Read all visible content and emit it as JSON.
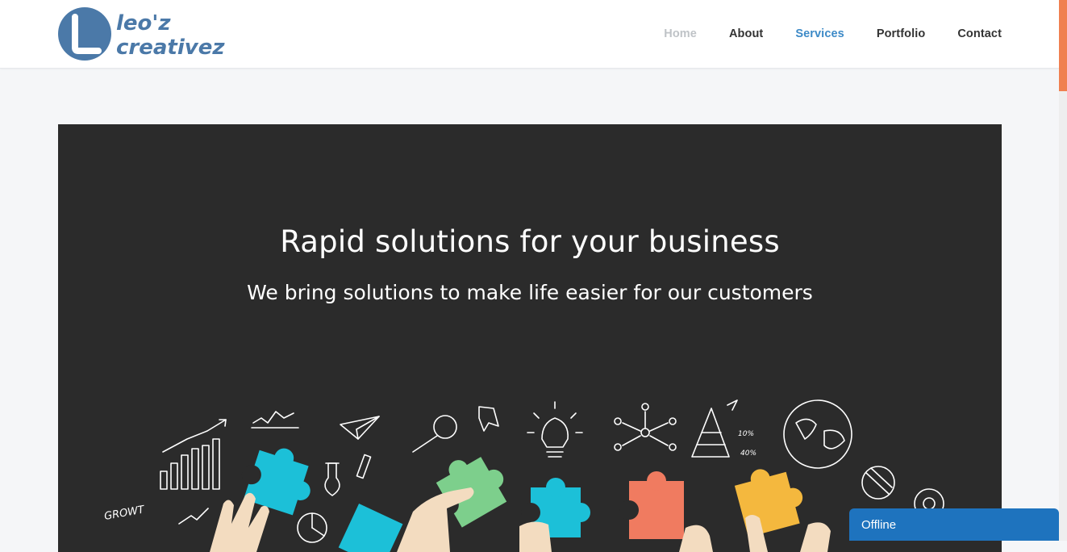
{
  "header": {
    "logo": {
      "line1": "leo'z",
      "line2": "creativez",
      "color": "#3e6fa3"
    },
    "nav": [
      {
        "label": "Home",
        "state": "muted"
      },
      {
        "label": "About",
        "state": "default"
      },
      {
        "label": "Services",
        "state": "active"
      },
      {
        "label": "Portfolio",
        "state": "default"
      },
      {
        "label": "Contact",
        "state": "default"
      }
    ]
  },
  "hero": {
    "title": "Rapid solutions for your business",
    "subtitle": "We bring solutions to make life easier for our customers",
    "illustration": {
      "doodle_texts": [
        "GROWT",
        "10%",
        "40%"
      ],
      "puzzle_colors": [
        "#1cc0d8",
        "#7dcf8c",
        "#f07b60",
        "#f4b83e"
      ]
    }
  },
  "chat_widget": {
    "label": "Offline"
  },
  "colors": {
    "accent": "#3d8ac7",
    "scroll_thumb": "#f08050",
    "chat": "#1e73be",
    "hero_bg": "#2b2b2b"
  }
}
